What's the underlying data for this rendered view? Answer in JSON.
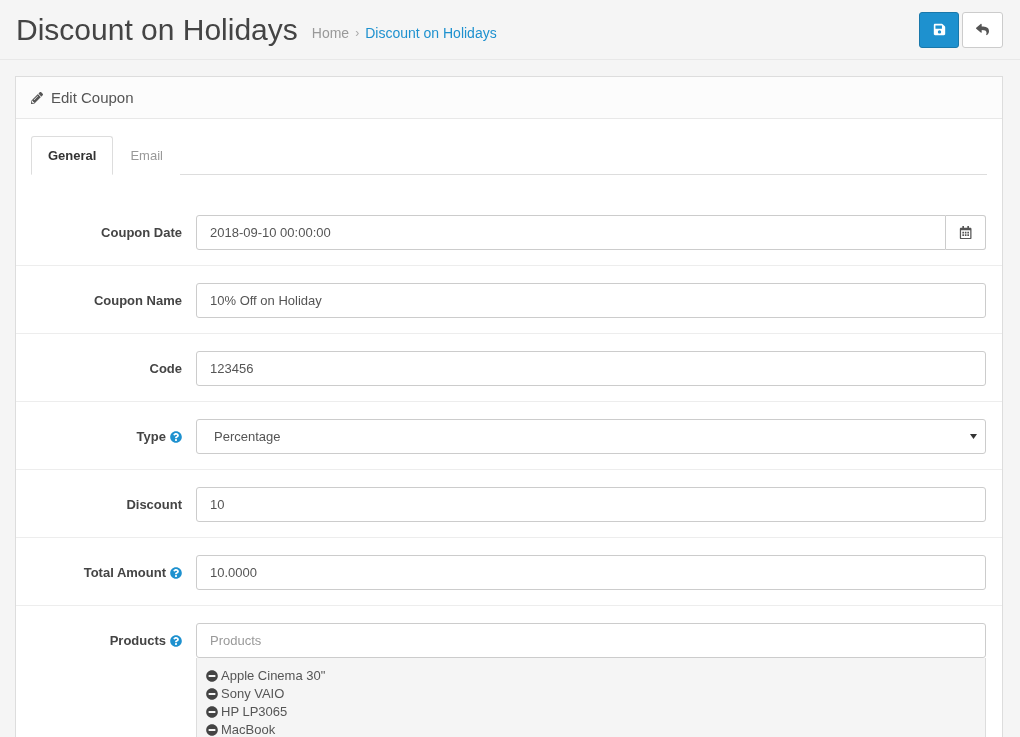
{
  "header": {
    "title": "Discount on Holidays",
    "separator": "›",
    "breadcrumb": [
      {
        "label": "Home",
        "current": false
      },
      {
        "label": "Discount on Holidays",
        "current": true
      }
    ],
    "buttons": [
      {
        "kind": "save"
      },
      {
        "kind": "back"
      }
    ]
  },
  "panel": {
    "title": "Edit Coupon",
    "tabs": [
      {
        "label": "General",
        "selected": true
      },
      {
        "label": "Email",
        "selected": false
      }
    ],
    "fields": [
      {
        "kind": "date",
        "label": "Coupon Date",
        "help": false,
        "value": "2018-09-10 00:00:00"
      },
      {
        "kind": "text",
        "label": "Coupon Name",
        "help": false,
        "value": "10% Off on Holiday"
      },
      {
        "kind": "text",
        "label": "Code",
        "help": false,
        "value": "123456"
      },
      {
        "kind": "select",
        "label": "Type",
        "help": true,
        "value": "Percentage"
      },
      {
        "kind": "text",
        "label": "Discount",
        "help": false,
        "value": "10"
      },
      {
        "kind": "text",
        "label": "Total Amount",
        "help": true,
        "value": "10.0000"
      },
      {
        "kind": "products",
        "label": "Products",
        "help": true,
        "placeholder": "Products",
        "items": [
          "Apple Cinema 30\"",
          "Sony VAIO",
          "HP LP3065",
          "MacBook"
        ]
      }
    ]
  }
}
